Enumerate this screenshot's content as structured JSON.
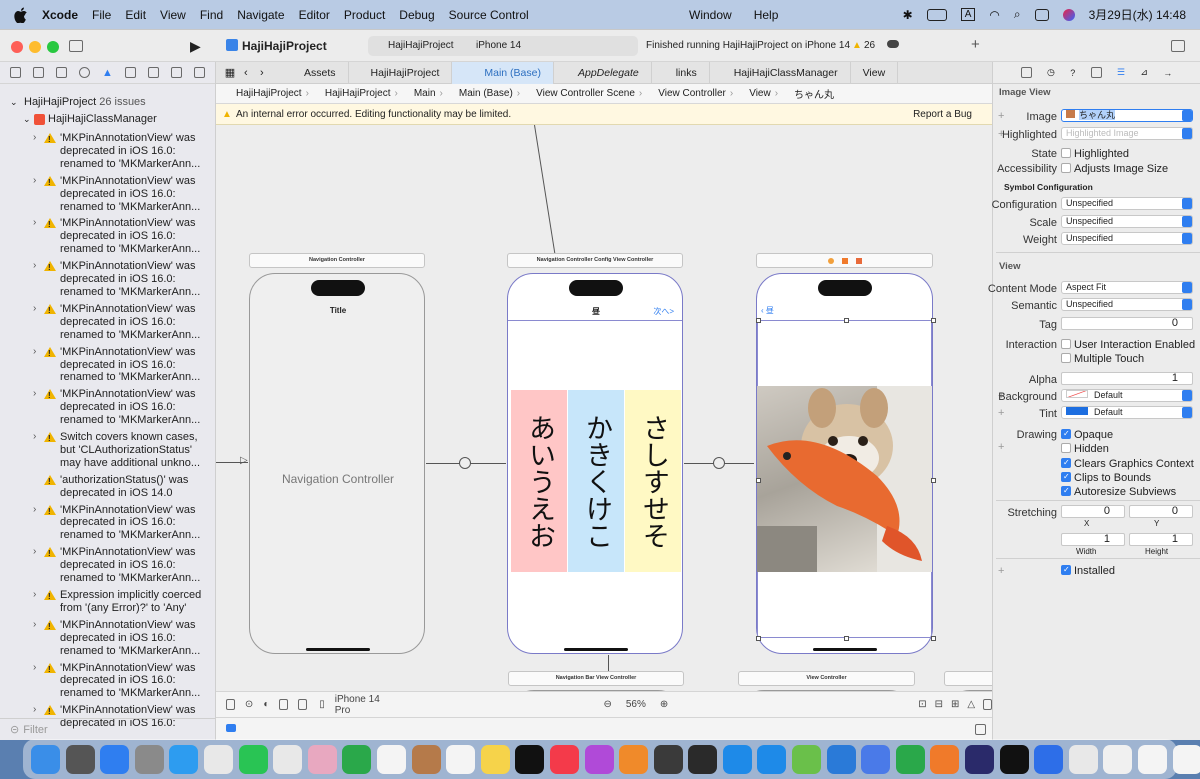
{
  "menubar": {
    "app": "Xcode",
    "items": [
      "File",
      "Edit",
      "View",
      "Find",
      "Navigate",
      "Editor",
      "Product",
      "Debug",
      "Source Control"
    ],
    "right_items": [
      "Window",
      "Help"
    ],
    "input_mode": "A",
    "datetime": "3月29日(水)  14:48"
  },
  "toolbar": {
    "project": "HajiHajiProject",
    "scheme": "HajiHajiProject",
    "device": "iPhone 14",
    "status": "Finished running HajiHajiProject on iPhone 14",
    "warnings": "26"
  },
  "navigator": {
    "project": "HajiHajiProject",
    "issues": "26 issues",
    "group": "HajiHajiClassManager",
    "items": [
      "'MKPinAnnotationView' was deprecated in iOS 16.0: renamed to 'MKMarkerAnn...",
      "'MKPinAnnotationView' was deprecated in iOS 16.0: renamed to 'MKMarkerAnn...",
      "'MKPinAnnotationView' was deprecated in iOS 16.0: renamed to 'MKMarkerAnn...",
      "'MKPinAnnotationView' was deprecated in iOS 16.0: renamed to 'MKMarkerAnn...",
      "'MKPinAnnotationView' was deprecated in iOS 16.0: renamed to 'MKMarkerAnn...",
      "'MKPinAnnotationView' was deprecated in iOS 16.0: renamed to 'MKMarkerAnn...",
      "'MKPinAnnotationView' was deprecated in iOS 16.0: renamed to 'MKMarkerAnn...",
      "Switch covers known cases, but 'CLAuthorizationStatus' may have additional unkno...",
      "'authorizationStatus()' was deprecated in iOS 14.0",
      "'MKPinAnnotationView' was deprecated in iOS 16.0: renamed to 'MKMarkerAnn...",
      "'MKPinAnnotationView' was deprecated in iOS 16.0: renamed to 'MKMarkerAnn...",
      "Expression implicitly coerced from '(any Error)?' to 'Any'",
      "'MKPinAnnotationView' was deprecated in iOS 16.0: renamed to 'MKMarkerAnn...",
      "'MKPinAnnotationView' was deprecated in iOS 16.0: renamed to 'MKMarkerAnn...",
      "'MKPinAnnotationView' was deprecated in iOS 16.0:"
    ],
    "filter_placeholder": "Filter"
  },
  "tabs": [
    "Assets",
    "HajiHajiProject",
    "Main (Base)",
    "AppDelegate",
    "links",
    "HajiHajiClassManager",
    "View"
  ],
  "jumpbar": [
    "HajiHajiProject",
    "HajiHajiProject",
    "Main",
    "Main (Base)",
    "View Controller Scene",
    "View Controller",
    "View",
    "ちゃん丸"
  ],
  "error_message": "An internal error occurred. Editing functionality may be limited.",
  "report_bug": "Report a Bug",
  "canvas": {
    "scene1": {
      "header": "Navigation Controller",
      "title": "Title",
      "body": "Navigation Controller"
    },
    "scene2": {
      "header": "Navigation Controller Config View Controller",
      "title": "昼",
      "next": "次へ>",
      "columns": [
        "あいうえお",
        "かきくけこ",
        "さしすせそ"
      ]
    },
    "scene3": {
      "back": "昼"
    },
    "scene4": {
      "header": "Navigation Bar View Controller"
    },
    "scene5": {
      "header": "View Controller"
    },
    "device": "iPhone 14 Pro",
    "zoom": "56%"
  },
  "inspector": {
    "title": "Image View",
    "image_label": "Image",
    "image_value": "ちゃん丸",
    "highlighted_label": "Highlighted",
    "highlighted_placeholder": "Highlighted Image",
    "state_label": "State",
    "state_value": "Highlighted",
    "accessibility_label": "Accessibility",
    "accessibility_value": "Adjusts Image Size",
    "symbol_section": "Symbol Configuration",
    "configuration_label": "Configuration",
    "configuration_value": "Unspecified",
    "scale_label": "Scale",
    "scale_value": "Unspecified",
    "weight_label": "Weight",
    "weight_value": "Unspecified",
    "view_section": "View",
    "content_mode_label": "Content Mode",
    "content_mode_value": "Aspect Fit",
    "semantic_label": "Semantic",
    "semantic_value": "Unspecified",
    "tag_label": "Tag",
    "tag_value": "0",
    "interaction_label": "Interaction",
    "user_interaction": "User Interaction Enabled",
    "multiple_touch": "Multiple Touch",
    "alpha_label": "Alpha",
    "alpha_value": "1",
    "background_label": "Background",
    "background_value": "Default",
    "tint_label": "Tint",
    "tint_value": "Default",
    "tint_color": "#1d6ee0",
    "drawing_label": "Drawing",
    "drawing": [
      "Opaque",
      "Hidden",
      "Clears Graphics Context",
      "Clips to Bounds",
      "Autoresize Subviews"
    ],
    "stretching_label": "Stretching",
    "stretch_x": "0",
    "stretch_y": "0",
    "stretch_w": "1",
    "stretch_h": "1",
    "x_label": "X",
    "y_label": "Y",
    "width_label": "Width",
    "height_label": "Height",
    "installed": "Installed"
  },
  "colors": {
    "accent": "#2f7ef0",
    "warning": "#f0b400",
    "pink": "#ffc6c6",
    "blue": "#c7e6fa",
    "yellow": "#fff9c4"
  }
}
